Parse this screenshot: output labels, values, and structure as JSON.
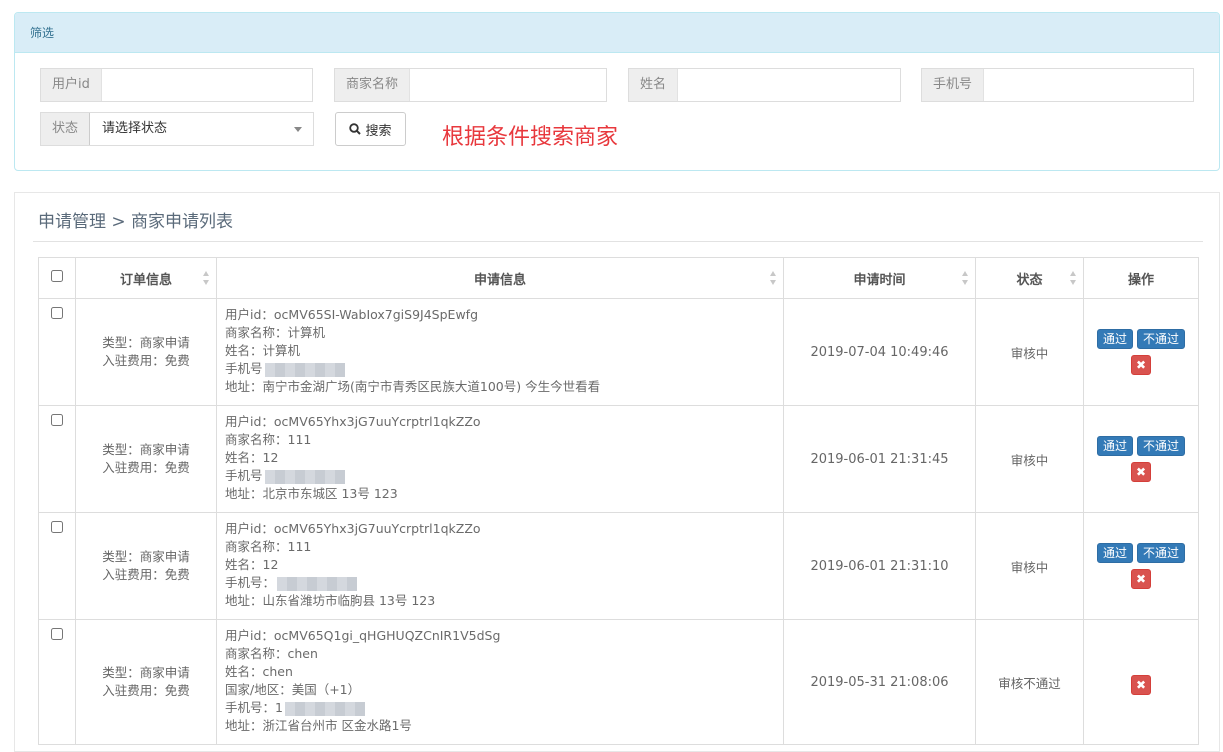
{
  "filter": {
    "header": "筛选",
    "user_id_label": "用户id",
    "merchant_name_label": "商家名称",
    "name_label": "姓名",
    "phone_label": "手机号",
    "status_label": "状态",
    "status_placeholder": "请选择状态",
    "search_button": "搜索",
    "hint": "根据条件搜索商家"
  },
  "breadcrumb": "申请管理 > 商家申请列表",
  "table": {
    "headers": [
      "订单信息",
      "申请信息",
      "申请时间",
      "状态",
      "操作"
    ],
    "rows": [
      {
        "order_type": "类型：商家申请",
        "order_fee": "入驻费用：免费",
        "user_id": "用户id：ocMV65SI-WabIox7giS9J4SpEwfg",
        "merchant": "商家名称：计算机",
        "name": "姓名：计算机",
        "phone": "手机号",
        "address": "地址：南宁市金湖广场(南宁市青秀区民族大道100号) 今生今世看看",
        "time": "2019-07-04 10:49:46",
        "status": "审核中",
        "pass": "通过",
        "reject": "不通过"
      },
      {
        "order_type": "类型：商家申请",
        "order_fee": "入驻费用：免费",
        "user_id": "用户id：ocMV65Yhx3jG7uuYcrptrl1qkZZo",
        "merchant": "商家名称：111",
        "name": "姓名：12",
        "phone": "手机号",
        "address": "地址：北京市东城区 13号 123",
        "time": "2019-06-01 21:31:45",
        "status": "审核中",
        "pass": "通过",
        "reject": "不通过"
      },
      {
        "order_type": "类型：商家申请",
        "order_fee": "入驻费用：免费",
        "user_id": "用户id：ocMV65Yhx3jG7uuYcrptrl1qkZZo",
        "merchant": "商家名称：111",
        "name": "姓名：12",
        "phone": "手机号：",
        "address": "地址：山东省潍坊市临朐县 13号 123",
        "time": "2019-06-01 21:31:10",
        "status": "审核中",
        "pass": "通过",
        "reject": "不通过"
      },
      {
        "order_type": "类型：商家申请",
        "order_fee": "入驻费用：免费",
        "user_id": "用户id：ocMV65Q1gi_qHGHUQZCnIR1V5dSg",
        "merchant": "商家名称：chen",
        "name": "姓名：chen",
        "region": "国家/地区：美国（+1）",
        "phone": "手机号：1",
        "address": "地址：浙江省台州市 区金水路1号",
        "time": "2019-05-31 21:08:06",
        "status": "审核不通过"
      }
    ]
  },
  "icons": {
    "search": "search-icon",
    "delete": "close-icon"
  },
  "colors": {
    "panel_head_bg": "#d9edf7",
    "primary": "#337ab7",
    "danger": "#d9534f",
    "hint": "#e8383d"
  }
}
